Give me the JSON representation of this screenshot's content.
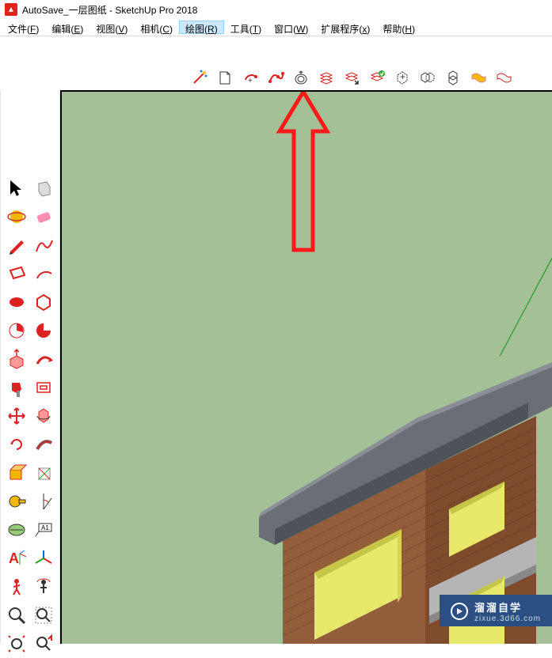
{
  "app": {
    "title": "AutoSave_一层图纸 - SketchUp Pro 2018"
  },
  "menu": {
    "items": [
      {
        "label": "文件",
        "accel": "F",
        "highlighted": false
      },
      {
        "label": "编辑",
        "accel": "E",
        "highlighted": false
      },
      {
        "label": "视图",
        "accel": "V",
        "highlighted": false
      },
      {
        "label": "相机",
        "accel": "C",
        "highlighted": false
      },
      {
        "label": "绘图",
        "accel": "R",
        "highlighted": true
      },
      {
        "label": "工具",
        "accel": "T",
        "highlighted": false
      },
      {
        "label": "窗口",
        "accel": "W",
        "highlighted": false
      },
      {
        "label": "扩展程序",
        "accel": "x",
        "highlighted": false
      },
      {
        "label": "帮助",
        "accel": "H",
        "highlighted": false
      }
    ]
  },
  "top_toolbar": {
    "icons": [
      "wand-icon",
      "page-icon",
      "arc-redo-icon",
      "bezier-icon",
      "onion-icon",
      "stack-icon",
      "stack-arrow-icon",
      "stack-check-icon",
      "hex-plus-icon",
      "hex-pair-icon",
      "hex-stack-icon",
      "ribbon-icon",
      "ribbon-open-icon"
    ]
  },
  "left_toolbar": {
    "rows": [
      [
        "select-arrow-icon",
        "cube-select-icon"
      ],
      [
        "orbit-icon",
        "eraser-icon"
      ],
      [
        "pencil-icon",
        "freehand-icon"
      ],
      [
        "rectangle-icon",
        "arc-icon"
      ],
      [
        "circle-icon",
        "polygon-icon"
      ],
      [
        "pie-icon",
        "pie2-icon"
      ],
      [
        "pushpull-icon",
        "follow-icon"
      ],
      [
        "paint-icon",
        "offset-icon"
      ],
      [
        "move-icon",
        "rotate3d-icon"
      ],
      [
        "rotate-icon",
        "scale-icon"
      ],
      [
        "section-icon",
        "axes-icon"
      ],
      [
        "tape-icon",
        "protractor-icon"
      ],
      [
        "dimension-icon",
        "text-label-icon"
      ],
      [
        "3dtext-icon",
        "axes3d-icon"
      ],
      [
        "walk-icon",
        "lookaround-icon"
      ],
      [
        "zoom-icon",
        "zoom-window-icon"
      ],
      [
        "zoom-extents-icon",
        "previous-icon"
      ]
    ]
  },
  "watermark": {
    "brand": "溜溜自学",
    "url": "zixue.3d66.com"
  }
}
